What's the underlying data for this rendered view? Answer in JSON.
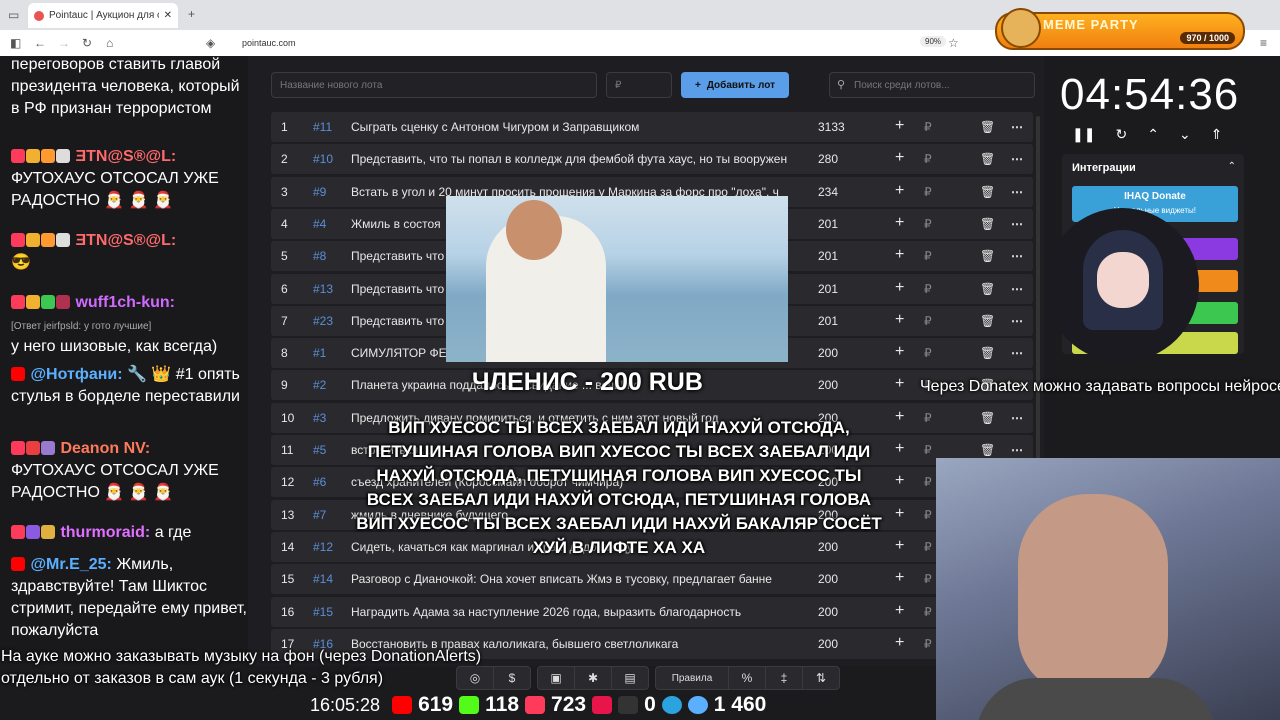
{
  "browser": {
    "tab_title": "Pointauc | Аукцион для стримe",
    "url": "pointauc.com",
    "zoom": "90%"
  },
  "meme_party": {
    "title": "MEME PARTY",
    "count": "970 / 1000"
  },
  "chat": {
    "messages": [
      {
        "text": "переговоров ставить главой президента человека, который в РФ признан террористом"
      },
      {
        "nick": "ƎTN@S®@L:",
        "text": "ФУТОХАУС ОТСОСАЛ УЖЕ РАДОСТНО 🎅 🎅 🎅"
      },
      {
        "nick": "ƎTN@S®@L:",
        "text": "😎"
      },
      {
        "nick": "wuff1ch-kun:",
        "reply": "[Ответ jeirfpsld: у гото лучшие]",
        "text": "у него шизовые, как всегда)"
      },
      {
        "nick": "@Нотфани:",
        "text": "🔧 👑 #1 опять стулья в борделе переставили"
      },
      {
        "nick": "Deanon NV:",
        "text": "ФУТОХАУС ОТСОСАЛ УЖЕ РАДОСТНО 🎅 🎅 🎅"
      },
      {
        "nick": "thurmoraid:",
        "text": "а где"
      },
      {
        "nick": "@Mr.E_25:",
        "text": "Жмиль, здравствуйте! Там Шиктос стримит, передайте ему привет, пожалуйста"
      }
    ]
  },
  "auction": {
    "new_lot_placeholder": "Название нового лота",
    "amount_placeholder": "₽",
    "add_lot_label": "Добавить лот",
    "search_placeholder": "Поиск среди лотов...",
    "rows": [
      {
        "n": "1",
        "id": "#11",
        "name": "Сыграть сценку с Антоном Чигуром и Заправщиком",
        "amount": "3133"
      },
      {
        "n": "2",
        "id": "#10",
        "name": "Представить, что ты попал в колледж для фембой фута хаус, но ты вооружен",
        "amount": "280"
      },
      {
        "n": "3",
        "id": "#9",
        "name": "Встать в угол и 20 минут просить прощения у Маркина за форс про \"лоха\", ч",
        "amount": "234"
      },
      {
        "n": "4",
        "id": "#4",
        "name": "Жмиль в состоя",
        "amount": "201"
      },
      {
        "n": "5",
        "id": "#8",
        "name": "Представить что",
        "amount": "201"
      },
      {
        "n": "6",
        "id": "#13",
        "name": "Представить что",
        "amount": "201"
      },
      {
        "n": "7",
        "id": "#23",
        "name": "Представить что",
        "amount": "201"
      },
      {
        "n": "8",
        "id": "#1",
        "name": "СИМУЛЯТОР ФЕ",
        "amount": "200"
      },
      {
        "n": "9",
        "id": "#2",
        "name": "Планета украина поддалось ... свидание ... вечь! по",
        "amount": "200"
      },
      {
        "n": "10",
        "id": "#3",
        "name": "Предложить дивану помириться, и отметить с ним этот новый год",
        "amount": "200"
      },
      {
        "n": "11",
        "id": "#5",
        "name": "встретиться ...",
        "amount": "200"
      },
      {
        "n": "12",
        "id": "#6",
        "name": "съезд хранителей (Короссмайл оборот чимчира)",
        "amount": "200"
      },
      {
        "n": "13",
        "id": "#7",
        "name": "жмиль в дневнике будущего",
        "amount": "200"
      },
      {
        "n": "14",
        "id": "#12",
        "name": "Сидеть, качаться как маргинал и тра... додо пиццу",
        "amount": "200"
      },
      {
        "n": "15",
        "id": "#14",
        "name": "Разговор с Дианочкой: Она хочет вписать Жмэ в тусовку, предлагает банне",
        "amount": "200"
      },
      {
        "n": "16",
        "id": "#15",
        "name": "Наградить Адама за наступление 2026 года, выразить благодарность",
        "amount": "200"
      },
      {
        "n": "17",
        "id": "#16",
        "name": "Восстановить в правах калоликага, бывшего светлоликага",
        "amount": "200"
      }
    ],
    "rules_label": "Правила"
  },
  "timer": {
    "value": "04:54:36"
  },
  "integrations": {
    "title": "Интеграции",
    "ihaq": "IHAQ Donate",
    "ihaq_sub": "Уникальные виджеты!",
    "last": "uet"
  },
  "alert": {
    "title": "ЧЛЕНИС - 200 RUB",
    "text": "ВИП ХУЕСОС ТЫ ВСЕХ ЗАЕБАЛ ИДИ НАХУЙ ОТСЮДА, ПЕТУШИНАЯ ГОЛОВА ВИП ХУЕСОС ТЫ ВСЕХ ЗАЕБАЛ ИДИ НАХУЙ ОТСЮДА, ПЕТУШИНАЯ ГОЛОВА ВИП ХУЕСОС ТЫ ВСЕХ ЗАЕБАЛ ИДИ НАХУЙ ОТСЮДА, ПЕТУШИНАЯ ГОЛОВА ВИП ХУЕСОС ТЫ ВСЕХ ЗАЕБАЛ ИДИ НАХУЙ БАКАЛЯР СОСЁТ ХУЙ В ЛИФТЕ ХА ХА"
  },
  "notes": {
    "donatex": "Через Donatex можно задавать вопросы нейросети",
    "music1": "На ауке можно заказывать музыку на фон (через DonationAlerts)",
    "music2": "отдельно от заказов в сам аук (1 секунда - 3 рубля)"
  },
  "stats": {
    "time": "16:05:28",
    "youtube": "619",
    "kick": "118",
    "vk": "723",
    "rumble": "0",
    "total": "1 460"
  },
  "colors": {
    "accent": "#5a9de8",
    "youtube": "#ff0000",
    "kick": "#53fc18",
    "vk": "#ff3b5c",
    "telegram": "#2aa3df"
  }
}
